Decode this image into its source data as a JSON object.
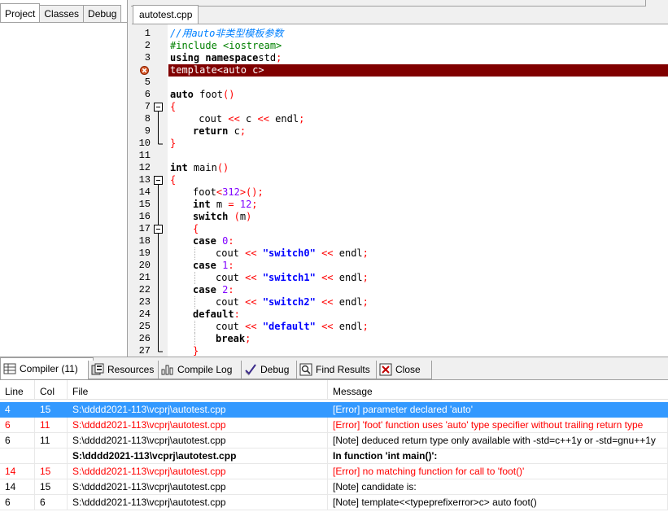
{
  "left_panel": {
    "tabs": [
      "Project",
      "Classes",
      "Debug"
    ]
  },
  "editor": {
    "tab_label": "autotest.cpp",
    "lines": [
      {
        "n": "1",
        "segs": [
          [
            "cm",
            "//用auto非类型模板参数"
          ]
        ]
      },
      {
        "n": "2",
        "segs": [
          [
            "pp",
            "#include <iostream>"
          ]
        ]
      },
      {
        "n": "3",
        "segs": [
          [
            "kw",
            "using namespace"
          ],
          [
            "",
            "std"
          ],
          [
            "sym",
            ";"
          ]
        ]
      },
      {
        "n": "",
        "error": true,
        "segs": [
          [
            "",
            "template<auto c>"
          ]
        ]
      },
      {
        "n": "5",
        "segs": []
      },
      {
        "n": "6",
        "segs": [
          [
            "kw",
            "auto"
          ],
          [
            "",
            " foot"
          ],
          [
            "sym",
            "()"
          ]
        ]
      },
      {
        "n": "7",
        "fold": "start",
        "segs": [
          [
            "sym",
            "{"
          ]
        ]
      },
      {
        "n": "8",
        "fold": "mid",
        "segs": [
          [
            "",
            " cout "
          ],
          [
            "sym",
            "<<"
          ],
          [
            "",
            " c "
          ],
          [
            "sym",
            "<<"
          ],
          [
            "",
            " endl"
          ],
          [
            "sym",
            ";"
          ]
        ],
        "indent": 1
      },
      {
        "n": "9",
        "fold": "mid",
        "segs": [
          [
            "kw",
            "return"
          ],
          [
            "",
            " c"
          ],
          [
            "sym",
            ";"
          ]
        ],
        "indent": 1
      },
      {
        "n": "10",
        "fold": "end",
        "segs": [
          [
            "sym",
            "}"
          ]
        ]
      },
      {
        "n": "11",
        "segs": []
      },
      {
        "n": "12",
        "segs": [
          [
            "kw",
            "int"
          ],
          [
            "",
            " main"
          ],
          [
            "sym",
            "()"
          ]
        ]
      },
      {
        "n": "13",
        "fold": "start",
        "segs": [
          [
            "sym",
            "{"
          ]
        ]
      },
      {
        "n": "14",
        "fold": "mid",
        "segs": [
          [
            "",
            "foot"
          ],
          [
            "sym",
            "<"
          ],
          [
            "num",
            "312"
          ],
          [
            "sym",
            ">();"
          ]
        ],
        "indent": 1
      },
      {
        "n": "15",
        "fold": "mid",
        "segs": [
          [
            "kw",
            "int"
          ],
          [
            "",
            " m "
          ],
          [
            "sym",
            "="
          ],
          [
            "",
            " "
          ],
          [
            "num",
            "12"
          ],
          [
            "sym",
            ";"
          ]
        ],
        "indent": 1
      },
      {
        "n": "16",
        "fold": "mid",
        "segs": [
          [
            "kw",
            "switch"
          ],
          [
            "",
            " "
          ],
          [
            "sym",
            "("
          ],
          [
            "",
            "m"
          ],
          [
            "sym",
            ")"
          ]
        ],
        "indent": 1
      },
      {
        "n": "17",
        "fold": "start2",
        "segs": [
          [
            "sym",
            "{"
          ]
        ],
        "indent": 1
      },
      {
        "n": "18",
        "fold": "mid",
        "segs": [
          [
            "kw",
            "case"
          ],
          [
            "",
            " "
          ],
          [
            "num",
            "0"
          ],
          [
            "sym",
            ":"
          ]
        ],
        "indent": 1
      },
      {
        "n": "19",
        "fold": "mid",
        "segs": [
          [
            "",
            "cout "
          ],
          [
            "sym",
            "<<"
          ],
          [
            "",
            " "
          ],
          [
            "str",
            "\"switch0\""
          ],
          [
            "",
            " "
          ],
          [
            "sym",
            "<<"
          ],
          [
            "",
            " endl"
          ],
          [
            "sym",
            ";"
          ]
        ],
        "indent": 2
      },
      {
        "n": "20",
        "fold": "mid",
        "segs": [
          [
            "kw",
            "case"
          ],
          [
            "",
            " "
          ],
          [
            "num",
            "1"
          ],
          [
            "sym",
            ":"
          ]
        ],
        "indent": 1
      },
      {
        "n": "21",
        "fold": "mid",
        "segs": [
          [
            "",
            "cout "
          ],
          [
            "sym",
            "<<"
          ],
          [
            "",
            " "
          ],
          [
            "str",
            "\"switch1\""
          ],
          [
            "",
            " "
          ],
          [
            "sym",
            "<<"
          ],
          [
            "",
            " endl"
          ],
          [
            "sym",
            ";"
          ]
        ],
        "indent": 2
      },
      {
        "n": "22",
        "fold": "mid",
        "segs": [
          [
            "kw",
            "case"
          ],
          [
            "",
            " "
          ],
          [
            "num",
            "2"
          ],
          [
            "sym",
            ":"
          ]
        ],
        "indent": 1
      },
      {
        "n": "23",
        "fold": "mid",
        "segs": [
          [
            "",
            "cout "
          ],
          [
            "sym",
            "<<"
          ],
          [
            "",
            " "
          ],
          [
            "str",
            "\"switch2\""
          ],
          [
            "",
            " "
          ],
          [
            "sym",
            "<<"
          ],
          [
            "",
            " endl"
          ],
          [
            "sym",
            ";"
          ]
        ],
        "indent": 2
      },
      {
        "n": "24",
        "fold": "mid",
        "segs": [
          [
            "kw",
            "default"
          ],
          [
            "sym",
            ":"
          ]
        ],
        "indent": 1
      },
      {
        "n": "25",
        "fold": "mid",
        "segs": [
          [
            "",
            "cout "
          ],
          [
            "sym",
            "<<"
          ],
          [
            "",
            " "
          ],
          [
            "str",
            "\"default\""
          ],
          [
            "",
            " "
          ],
          [
            "sym",
            "<<"
          ],
          [
            "",
            " endl"
          ],
          [
            "sym",
            ";"
          ]
        ],
        "indent": 2
      },
      {
        "n": "26",
        "fold": "mid",
        "segs": [
          [
            "kw",
            "break"
          ],
          [
            "sym",
            ";"
          ]
        ],
        "indent": 2
      },
      {
        "n": "27",
        "fold": "end",
        "segs": [
          [
            "sym",
            "}"
          ]
        ],
        "indent": 1
      }
    ]
  },
  "bottom_tabs": [
    {
      "label": "Compiler (11)",
      "icon": "grid-icon",
      "active": true
    },
    {
      "label": "Resources",
      "icon": "resources-icon"
    },
    {
      "label": "Compile Log",
      "icon": "bar-chart-icon"
    },
    {
      "label": "Debug",
      "icon": "checkmark-icon"
    },
    {
      "label": "Find Results",
      "icon": "magnifier-icon"
    },
    {
      "label": "Close",
      "icon": "close-icon"
    }
  ],
  "table": {
    "headers": [
      "Line",
      "Col",
      "File",
      "Message"
    ],
    "rows": [
      {
        "line": "4",
        "col": "15",
        "file": "S:\\dddd2021-113\\vcprj\\autotest.cpp",
        "msg": "[Error] parameter declared 'auto'",
        "style": "sel"
      },
      {
        "line": "6",
        "col": "11",
        "file": "S:\\dddd2021-113\\vcprj\\autotest.cpp",
        "msg": "[Error] 'foot' function uses 'auto' type specifier without trailing return type",
        "style": "red"
      },
      {
        "line": "6",
        "col": "11",
        "file": "S:\\dddd2021-113\\vcprj\\autotest.cpp",
        "msg": "[Note] deduced return type only available with -std=c++1y or -std=gnu++1y",
        "style": ""
      },
      {
        "line": "",
        "col": "",
        "file": "S:\\dddd2021-113\\vcprj\\autotest.cpp",
        "msg": "In function 'int main()':",
        "style": "bold"
      },
      {
        "line": "14",
        "col": "15",
        "file": "S:\\dddd2021-113\\vcprj\\autotest.cpp",
        "msg": "[Error] no matching function for call to 'foot()'",
        "style": "red"
      },
      {
        "line": "14",
        "col": "15",
        "file": "S:\\dddd2021-113\\vcprj\\autotest.cpp",
        "msg": "[Note] candidate is:",
        "style": ""
      },
      {
        "line": "6",
        "col": "6",
        "file": "S:\\dddd2021-113\\vcprj\\autotest.cpp",
        "msg": "[Note] template<<typeprefixerror>c> auto foot()",
        "style": ""
      }
    ]
  }
}
